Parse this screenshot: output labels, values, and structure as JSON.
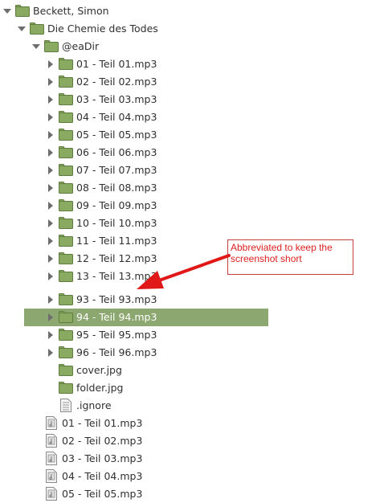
{
  "tree": [
    {
      "label": "Beckett, Simon",
      "type": "folder",
      "level": 0,
      "expander": "open"
    },
    {
      "label": "Die Chemie des Todes",
      "type": "folder",
      "level": 1,
      "expander": "open"
    },
    {
      "label": "@eaDir",
      "type": "folder",
      "level": 2,
      "expander": "open"
    },
    {
      "label": "01 - Teil 01.mp3",
      "type": "folder",
      "level": 3,
      "expander": "closed"
    },
    {
      "label": "02 - Teil 02.mp3",
      "type": "folder",
      "level": 3,
      "expander": "closed"
    },
    {
      "label": "03 - Teil 03.mp3",
      "type": "folder",
      "level": 3,
      "expander": "closed"
    },
    {
      "label": "04 - Teil 04.mp3",
      "type": "folder",
      "level": 3,
      "expander": "closed"
    },
    {
      "label": "05 - Teil 05.mp3",
      "type": "folder",
      "level": 3,
      "expander": "closed"
    },
    {
      "label": "06 - Teil 06.mp3",
      "type": "folder",
      "level": 3,
      "expander": "closed"
    },
    {
      "label": "07 - Teil 07.mp3",
      "type": "folder",
      "level": 3,
      "expander": "closed"
    },
    {
      "label": "08 - Teil 08.mp3",
      "type": "folder",
      "level": 3,
      "expander": "closed"
    },
    {
      "label": "09 - Teil 09.mp3",
      "type": "folder",
      "level": 3,
      "expander": "closed"
    },
    {
      "label": "10 - Teil 10.mp3",
      "type": "folder",
      "level": 3,
      "expander": "closed"
    },
    {
      "label": "11 - Teil 11.mp3",
      "type": "folder",
      "level": 3,
      "expander": "closed"
    },
    {
      "label": "12 - Teil 12.mp3",
      "type": "folder",
      "level": 3,
      "expander": "closed"
    },
    {
      "label": "13 - Teil 13.mp3",
      "type": "folder",
      "level": 3,
      "expander": "closed",
      "gap_after": true
    },
    {
      "label": "93 - Teil 93.mp3",
      "type": "folder",
      "level": 3,
      "expander": "closed"
    },
    {
      "label": "94 - Teil 94.mp3",
      "type": "folder",
      "level": 3,
      "expander": "closed",
      "selected": true
    },
    {
      "label": "95 - Teil 95.mp3",
      "type": "folder",
      "level": 3,
      "expander": "closed"
    },
    {
      "label": "96 - Teil 96.mp3",
      "type": "folder",
      "level": 3,
      "expander": "closed"
    },
    {
      "label": "cover.jpg",
      "type": "folder",
      "level": 3,
      "expander": "none"
    },
    {
      "label": "folder.jpg",
      "type": "folder",
      "level": 3,
      "expander": "none"
    },
    {
      "label": ".ignore",
      "type": "file",
      "level": 3,
      "expander": "none"
    },
    {
      "label": "01 - Teil 01.mp3",
      "type": "audio",
      "level": 2,
      "expander": "none"
    },
    {
      "label": "02 - Teil 02.mp3",
      "type": "audio",
      "level": 2,
      "expander": "none"
    },
    {
      "label": "03 - Teil 03.mp3",
      "type": "audio",
      "level": 2,
      "expander": "none"
    },
    {
      "label": "04 - Teil 04.mp3",
      "type": "audio",
      "level": 2,
      "expander": "none"
    },
    {
      "label": "05 - Teil 05.mp3",
      "type": "audio",
      "level": 2,
      "expander": "none"
    }
  ],
  "annotation": {
    "text": "Abbreviated to keep the screenshot short",
    "color": "#e02020"
  },
  "colors": {
    "folder": "#8aaa62",
    "folder_border": "#5f7d3f",
    "selection": "#8ca870",
    "expander": "#6d6d6d"
  }
}
